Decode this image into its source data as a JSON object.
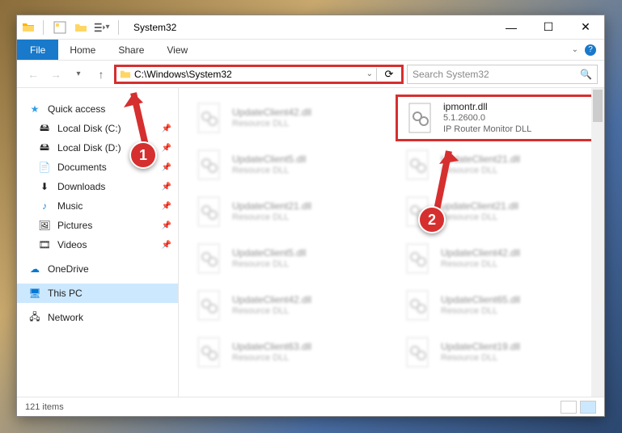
{
  "window": {
    "title": "System32"
  },
  "ribbon": {
    "file": "File",
    "tabs": [
      "Home",
      "Share",
      "View"
    ]
  },
  "address": {
    "path": "C:\\Windows\\System32"
  },
  "search": {
    "placeholder": "Search System32"
  },
  "nav": {
    "quick_access": "Quick access",
    "items": [
      {
        "label": "Local Disk (C:)",
        "icon": "drive",
        "pinned": true
      },
      {
        "label": "Local Disk (D:)",
        "icon": "drive",
        "pinned": true
      },
      {
        "label": "Documents",
        "icon": "doc",
        "pinned": true
      },
      {
        "label": "Downloads",
        "icon": "down",
        "pinned": true
      },
      {
        "label": "Music",
        "icon": "music",
        "pinned": true
      },
      {
        "label": "Pictures",
        "icon": "pic",
        "pinned": true
      },
      {
        "label": "Videos",
        "icon": "vid",
        "pinned": true
      }
    ],
    "onedrive": "OneDrive",
    "thispc": "This PC",
    "network": "Network"
  },
  "files": {
    "highlighted": {
      "name": "ipmontr.dll",
      "version": "5.1.2600.0",
      "desc": "IP Router Monitor DLL"
    },
    "bg": [
      {
        "name": "UpdateClient42.dll",
        "sub": "Resource DLL"
      },
      {
        "name": "UpdateClient5.dll",
        "sub": "Resource DLL"
      },
      {
        "name": "UpdateClient21.dll",
        "sub": "Resource DLL"
      },
      {
        "name": "UpdateClient21.dll",
        "sub": "Resource DLL"
      },
      {
        "name": "updateClient21.dll",
        "sub": "Resource DLL"
      },
      {
        "name": "UpdateClient5.dll",
        "sub": "Resource DLL"
      },
      {
        "name": "UpdateClient42.dll",
        "sub": "Resource DLL"
      },
      {
        "name": "UpdateClient42.dll",
        "sub": "Resource DLL"
      },
      {
        "name": "UpdateClient65.dll",
        "sub": "Resource DLL"
      },
      {
        "name": "UpdateClient63.dll",
        "sub": "Resource DLL"
      },
      {
        "name": "UpdateClient19.dll",
        "sub": "Resource DLL"
      }
    ]
  },
  "status": {
    "count": "121 items"
  },
  "callouts": {
    "one": "1",
    "two": "2"
  }
}
